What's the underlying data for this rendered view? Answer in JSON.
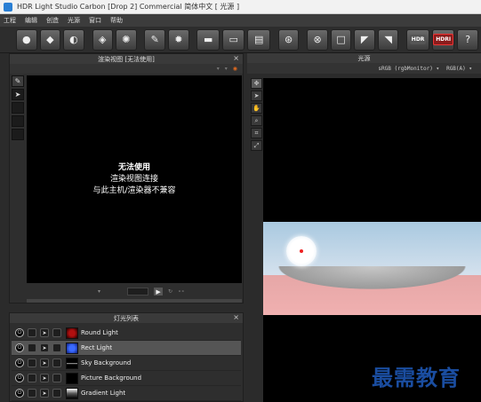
{
  "window": {
    "title": "HDR Light Studio Carbon [Drop 2] Commercial  简体中文 [ 光源 ]"
  },
  "menu": [
    "工程",
    "编辑",
    "创造",
    "光源",
    "窗口",
    "帮助"
  ],
  "toolbar": {
    "hdr_label": "HDR",
    "hdri_label": "HDRI",
    "help_label": "?"
  },
  "render_panel": {
    "title": "渲染视图 [无法使用]",
    "close": "×",
    "message_title": "无法使用",
    "message_line1": "渲染视图连接",
    "message_line2": "与此主机/渲染器不兼容"
  },
  "light_view": {
    "title": "光源",
    "colorspace": "sRGB (rgbMonitor)",
    "channels": "RGB(A)"
  },
  "light_list": {
    "title": "灯光列表",
    "close": "×",
    "items": [
      {
        "name": "Round Light",
        "selected": false
      },
      {
        "name": "Rect Light",
        "selected": true
      },
      {
        "name": "Sky Background",
        "selected": false
      },
      {
        "name": "Picture Background",
        "selected": false
      },
      {
        "name": "Gradient Light",
        "selected": false
      }
    ]
  },
  "watermark": "最需教育",
  "colors": {
    "panel_bg": "#2e2e2e",
    "selected_row": "#555555",
    "sky": "#a9c9e0",
    "ground": "#f0b0b0",
    "watermark": "#1a4da0"
  }
}
